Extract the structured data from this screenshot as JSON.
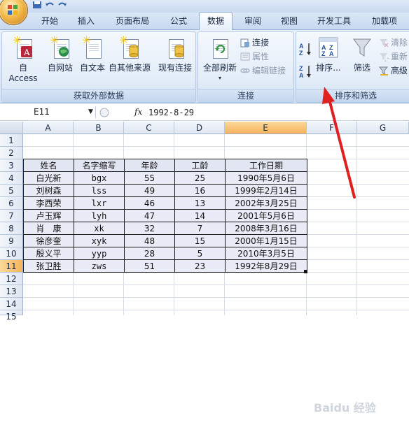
{
  "tabs": [
    "开始",
    "插入",
    "页面布局",
    "公式",
    "数据",
    "审阅",
    "视图",
    "开发工具",
    "加载项"
  ],
  "active_tab": "数据",
  "ribbon": {
    "external": {
      "label": "获取外部数据",
      "buttons": [
        "自 Access",
        "自网站",
        "自文本",
        "自其他来源",
        "现有连接"
      ]
    },
    "connections": {
      "label": "连接",
      "refresh_all": "全部刷新",
      "items": [
        "连接",
        "属性",
        "编辑链接"
      ]
    },
    "sortfilter": {
      "label": "排序和筛选",
      "sort": "排序...",
      "filter": "筛选",
      "items": [
        "清除",
        "重新",
        "高级"
      ]
    }
  },
  "formula_bar": {
    "name_box": "E11",
    "fx": "fx",
    "value": "1992-8-29"
  },
  "sheet": {
    "columns": [
      "A",
      "B",
      "C",
      "D",
      "E",
      "F",
      "G"
    ],
    "selected_column": "E",
    "rows": [
      "1",
      "2",
      "3",
      "4",
      "5",
      "6",
      "7",
      "8",
      "9",
      "10",
      "11",
      "12",
      "13",
      "14",
      "15"
    ],
    "selected_row": "11",
    "table_header": [
      "姓名",
      "名字缩写",
      "年龄",
      "工龄",
      "工作日期"
    ],
    "table_rows": [
      [
        "白光新",
        "bgx",
        "55",
        "25",
        "1990年5月6日"
      ],
      [
        "刘树森",
        "lss",
        "49",
        "16",
        "1999年2月14日"
      ],
      [
        "李西荣",
        "lxr",
        "46",
        "13",
        "2002年3月25日"
      ],
      [
        "卢玉辉",
        "lyh",
        "47",
        "14",
        "2001年5月6日"
      ],
      [
        "肖　康",
        "xk",
        "32",
        "7",
        "2008年3月16日"
      ],
      [
        "徐彦奎",
        "xyk",
        "48",
        "15",
        "2000年1月15日"
      ],
      [
        "殷义平",
        "yyp",
        "28",
        "5",
        "2010年3月5日"
      ],
      [
        "张卫胜",
        "zws",
        "51",
        "23",
        "1992年8月29日"
      ]
    ]
  },
  "watermark": "Baidu 经验"
}
